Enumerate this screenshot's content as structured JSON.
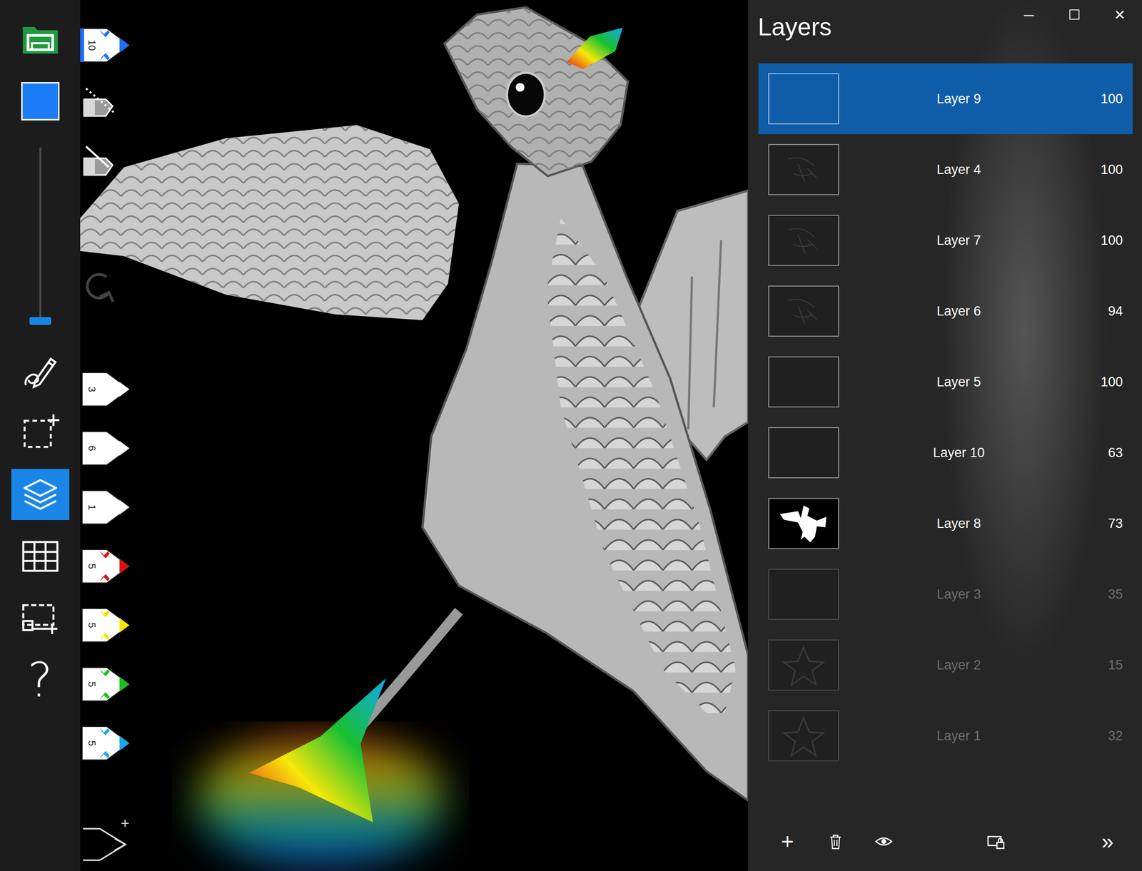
{
  "toolbar": {
    "items": [
      {
        "kind": "folder",
        "selected": false
      },
      {
        "kind": "color",
        "selected": false,
        "color": "#1a7cf7"
      },
      {
        "kind": "slider",
        "selected": false,
        "level": 0.02
      },
      {
        "kind": "pen",
        "selected": false
      },
      {
        "kind": "select",
        "selected": false
      },
      {
        "kind": "layers",
        "selected": true
      },
      {
        "kind": "grid",
        "selected": false
      },
      {
        "kind": "screen",
        "selected": false
      },
      {
        "kind": "help",
        "selected": false,
        "label": "?"
      }
    ]
  },
  "pens": [
    {
      "kind": "pen",
      "size": "10",
      "color": "#1e6fff",
      "selected": true
    },
    {
      "kind": "eraser-dotted",
      "selected": false
    },
    {
      "kind": "eraser",
      "selected": false
    },
    {
      "kind": "pen",
      "size": "3",
      "color": "#ffffff",
      "selected": false
    },
    {
      "kind": "pen",
      "size": "6",
      "color": "#ffffff",
      "selected": false
    },
    {
      "kind": "pen",
      "size": "1",
      "color": "#ffffff",
      "selected": false
    },
    {
      "kind": "pen",
      "size": "5",
      "color": "#e01010",
      "selected": false
    },
    {
      "kind": "pen",
      "size": "5",
      "color": "#f5e600",
      "selected": false
    },
    {
      "kind": "pen",
      "size": "5",
      "color": "#19c219",
      "selected": false
    },
    {
      "kind": "pen",
      "size": "5",
      "color": "#19a8ef",
      "selected": false
    }
  ],
  "add_pen": {
    "label": "+"
  },
  "panel": {
    "title": "Layers",
    "controls": [
      "─",
      "☐",
      "✕"
    ]
  },
  "layers": [
    {
      "name": "Layer 9",
      "opacity": "100",
      "selected": true,
      "visible": true,
      "thumb": "blank"
    },
    {
      "name": "Layer 4",
      "opacity": "100",
      "selected": false,
      "visible": true,
      "thumb": "sketch"
    },
    {
      "name": "Layer 7",
      "opacity": "100",
      "selected": false,
      "visible": true,
      "thumb": "sketch"
    },
    {
      "name": "Layer 6",
      "opacity": "94",
      "selected": false,
      "visible": true,
      "thumb": "sketch"
    },
    {
      "name": "Layer 5",
      "opacity": "100",
      "selected": false,
      "visible": true,
      "thumb": "blank"
    },
    {
      "name": "Layer 10",
      "opacity": "63",
      "selected": false,
      "visible": true,
      "thumb": "blank"
    },
    {
      "name": "Layer 8",
      "opacity": "73",
      "selected": false,
      "visible": true,
      "thumb": "silhouette"
    },
    {
      "name": "Layer 3",
      "opacity": "35",
      "selected": false,
      "visible": false,
      "thumb": "blank"
    },
    {
      "name": "Layer 2",
      "opacity": "15",
      "selected": false,
      "visible": false,
      "thumb": "star"
    },
    {
      "name": "Layer 1",
      "opacity": "32",
      "selected": false,
      "visible": false,
      "thumb": "star"
    }
  ],
  "layer_actions": [
    {
      "kind": "add",
      "label": "+"
    },
    {
      "kind": "delete"
    },
    {
      "kind": "visibility"
    },
    {
      "kind": "lock"
    },
    {
      "kind": "expand",
      "label": "»"
    }
  ]
}
